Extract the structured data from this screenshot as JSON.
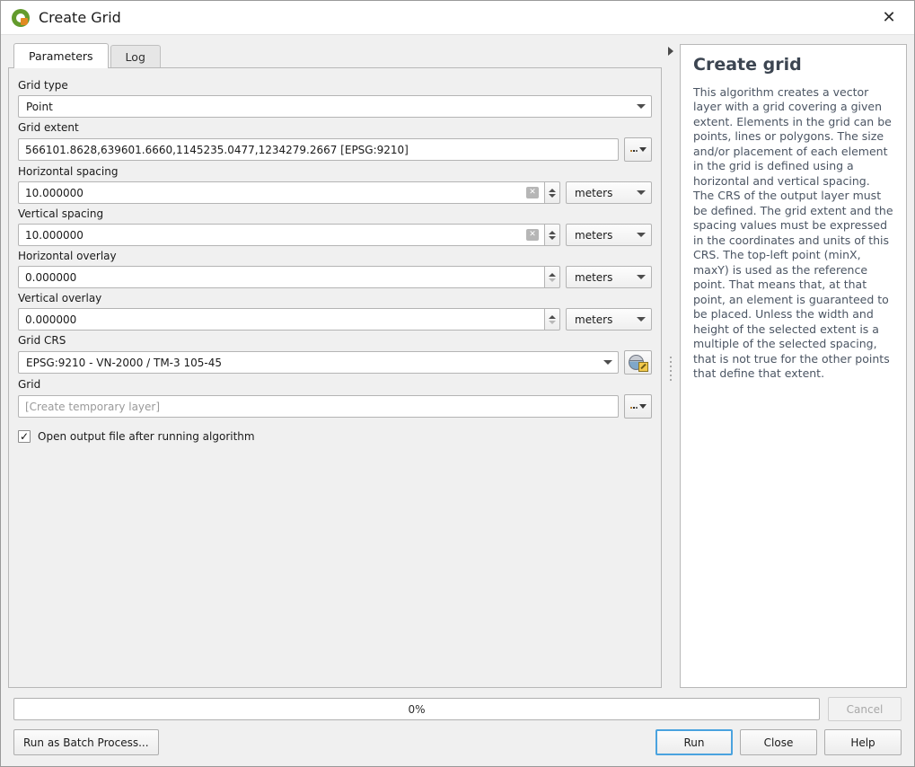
{
  "window": {
    "title": "Create Grid",
    "logo_icon": "qgis-logo-icon",
    "close_icon": "close-icon"
  },
  "tabs": [
    {
      "label": "Parameters",
      "active": true
    },
    {
      "label": "Log",
      "active": false
    }
  ],
  "parameters": {
    "grid_type": {
      "label": "Grid type",
      "value": "Point"
    },
    "grid_extent": {
      "label": "Grid extent",
      "value": "566101.8628,639601.6660,1145235.0477,1234279.2667 [EPSG:9210]",
      "browse_icon": "ellipsis-dropdown-icon"
    },
    "horizontal_spacing": {
      "label": "Horizontal spacing",
      "value": "10.000000",
      "unit": "meters",
      "clear_icon": "clear-icon"
    },
    "vertical_spacing": {
      "label": "Vertical spacing",
      "value": "10.000000",
      "unit": "meters",
      "clear_icon": "clear-icon"
    },
    "horizontal_overlay": {
      "label": "Horizontal overlay",
      "value": "0.000000",
      "unit": "meters"
    },
    "vertical_overlay": {
      "label": "Vertical overlay",
      "value": "0.000000",
      "unit": "meters"
    },
    "grid_crs": {
      "label": "Grid CRS",
      "value": "EPSG:9210 - VN-2000 / TM-3 105-45",
      "select_icon": "crs-globe-icon"
    },
    "grid_output": {
      "label": "Grid",
      "value": "",
      "placeholder": "[Create temporary layer]",
      "browse_icon": "ellipsis-dropdown-icon"
    },
    "open_output": {
      "label": "Open output file after running algorithm",
      "checked": true,
      "tick": "✓"
    }
  },
  "splitter": {
    "collapse_icon": "collapse-right-arrow-icon"
  },
  "help": {
    "title": "Create grid",
    "body": "This algorithm creates a vector layer with a grid covering a given extent. Elements in the grid can be points, lines or polygons. The size and/or placement of each element in the grid is defined using a horizontal and vertical spacing. The CRS of the output layer must be defined. The grid extent and the spacing values must be expressed in the coordinates and units of this CRS. The top-left point (minX, maxY) is used as the reference point. That means that, at that point, an element is guaranteed to be placed. Unless the width and height of the selected extent is a multiple of the selected spacing, that is not true for the other points that define that extent."
  },
  "footer": {
    "progress_text": "0%",
    "progress_value": 0,
    "cancel_label": "Cancel",
    "batch_label": "Run as Batch Process...",
    "run_label": "Run",
    "close_label": "Close",
    "help_label": "Help"
  },
  "colors": {
    "accent_focus": "#4aa3df",
    "panel_bg": "#f0f0f0",
    "field_bg": "#ffffff",
    "help_text": "#4b5563",
    "logo_green": "#639b2d",
    "logo_orange": "#e08b21"
  }
}
